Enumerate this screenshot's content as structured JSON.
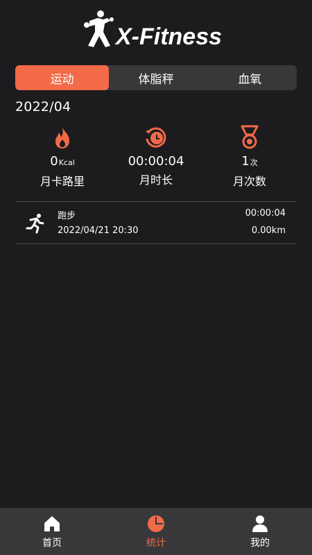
{
  "app": {
    "logo_text": "X-Fitness"
  },
  "tabs": [
    {
      "label": "运动",
      "active": true
    },
    {
      "label": "体脂秤",
      "active": false
    },
    {
      "label": "血氧",
      "active": false
    }
  ],
  "month": "2022/04",
  "stats": {
    "calories": {
      "value": "0",
      "unit": "Kcal",
      "label": "月卡路里",
      "icon": "flame-icon"
    },
    "duration": {
      "value": "00:00:04",
      "label": "月时长",
      "icon": "clock-icon"
    },
    "count": {
      "value": "1",
      "unit": "次",
      "label": "月次数",
      "icon": "medal-icon"
    }
  },
  "records": [
    {
      "icon": "running-icon",
      "name": "跑步",
      "datetime": "2022/04/21 20:30",
      "duration": "00:00:04",
      "distance": "0.00km"
    }
  ],
  "bottom_nav": [
    {
      "label": "首页",
      "icon": "home-icon",
      "active": false
    },
    {
      "label": "统计",
      "icon": "pie-chart-icon",
      "active": true
    },
    {
      "label": "我的",
      "icon": "user-icon",
      "active": false
    }
  ],
  "colors": {
    "accent": "#f26a48",
    "background": "#1c1c1e",
    "surface": "#38383a"
  }
}
